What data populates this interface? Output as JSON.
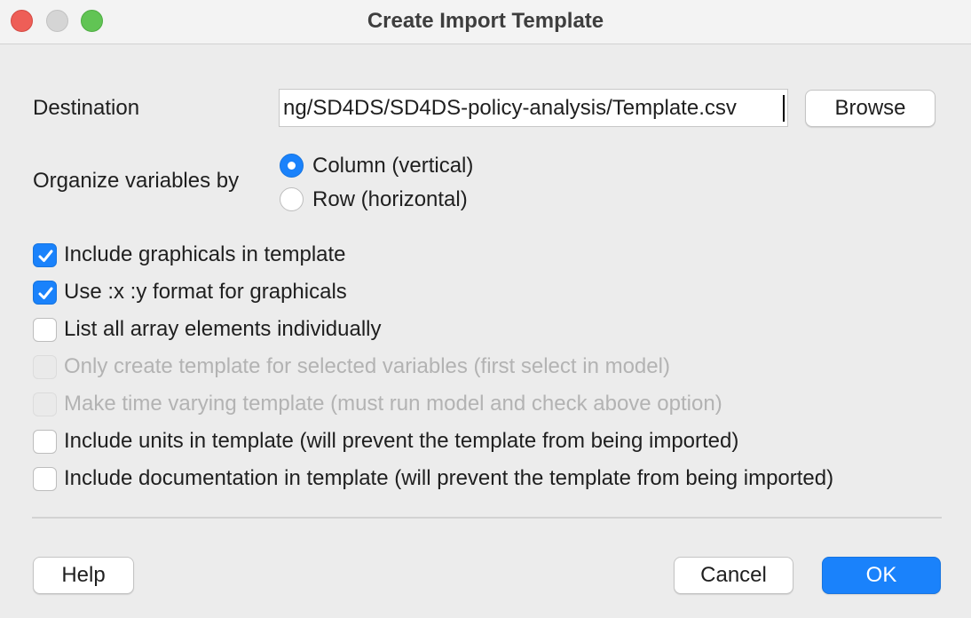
{
  "window": {
    "title": "Create Import Template"
  },
  "destination": {
    "label": "Destination",
    "value": "ng/SD4DS/SD4DS-policy-analysis/Template.csv",
    "browse_label": "Browse"
  },
  "organize": {
    "label": "Organize variables by",
    "options": [
      {
        "label": "Column (vertical)",
        "selected": true
      },
      {
        "label": "Row (horizontal)",
        "selected": false
      }
    ]
  },
  "options": [
    {
      "label": "Include graphicals in template",
      "checked": true,
      "enabled": true
    },
    {
      "label": "Use :x :y format for graphicals",
      "checked": true,
      "enabled": true
    },
    {
      "label": "List all array elements individually",
      "checked": false,
      "enabled": true
    },
    {
      "label": "Only create template for selected variables (first select in model)",
      "checked": false,
      "enabled": false
    },
    {
      "label": "Make time varying template (must run model and check above option)",
      "checked": false,
      "enabled": false
    },
    {
      "label": "Include units in template (will prevent the template from being imported)",
      "checked": false,
      "enabled": true
    },
    {
      "label": "Include documentation in template (will prevent the template from being imported)",
      "checked": false,
      "enabled": true
    }
  ],
  "buttons": {
    "help": "Help",
    "cancel": "Cancel",
    "ok": "OK"
  },
  "colors": {
    "accent": "#1a82fb",
    "close": "#ee5e57",
    "maximize": "#61c454"
  }
}
